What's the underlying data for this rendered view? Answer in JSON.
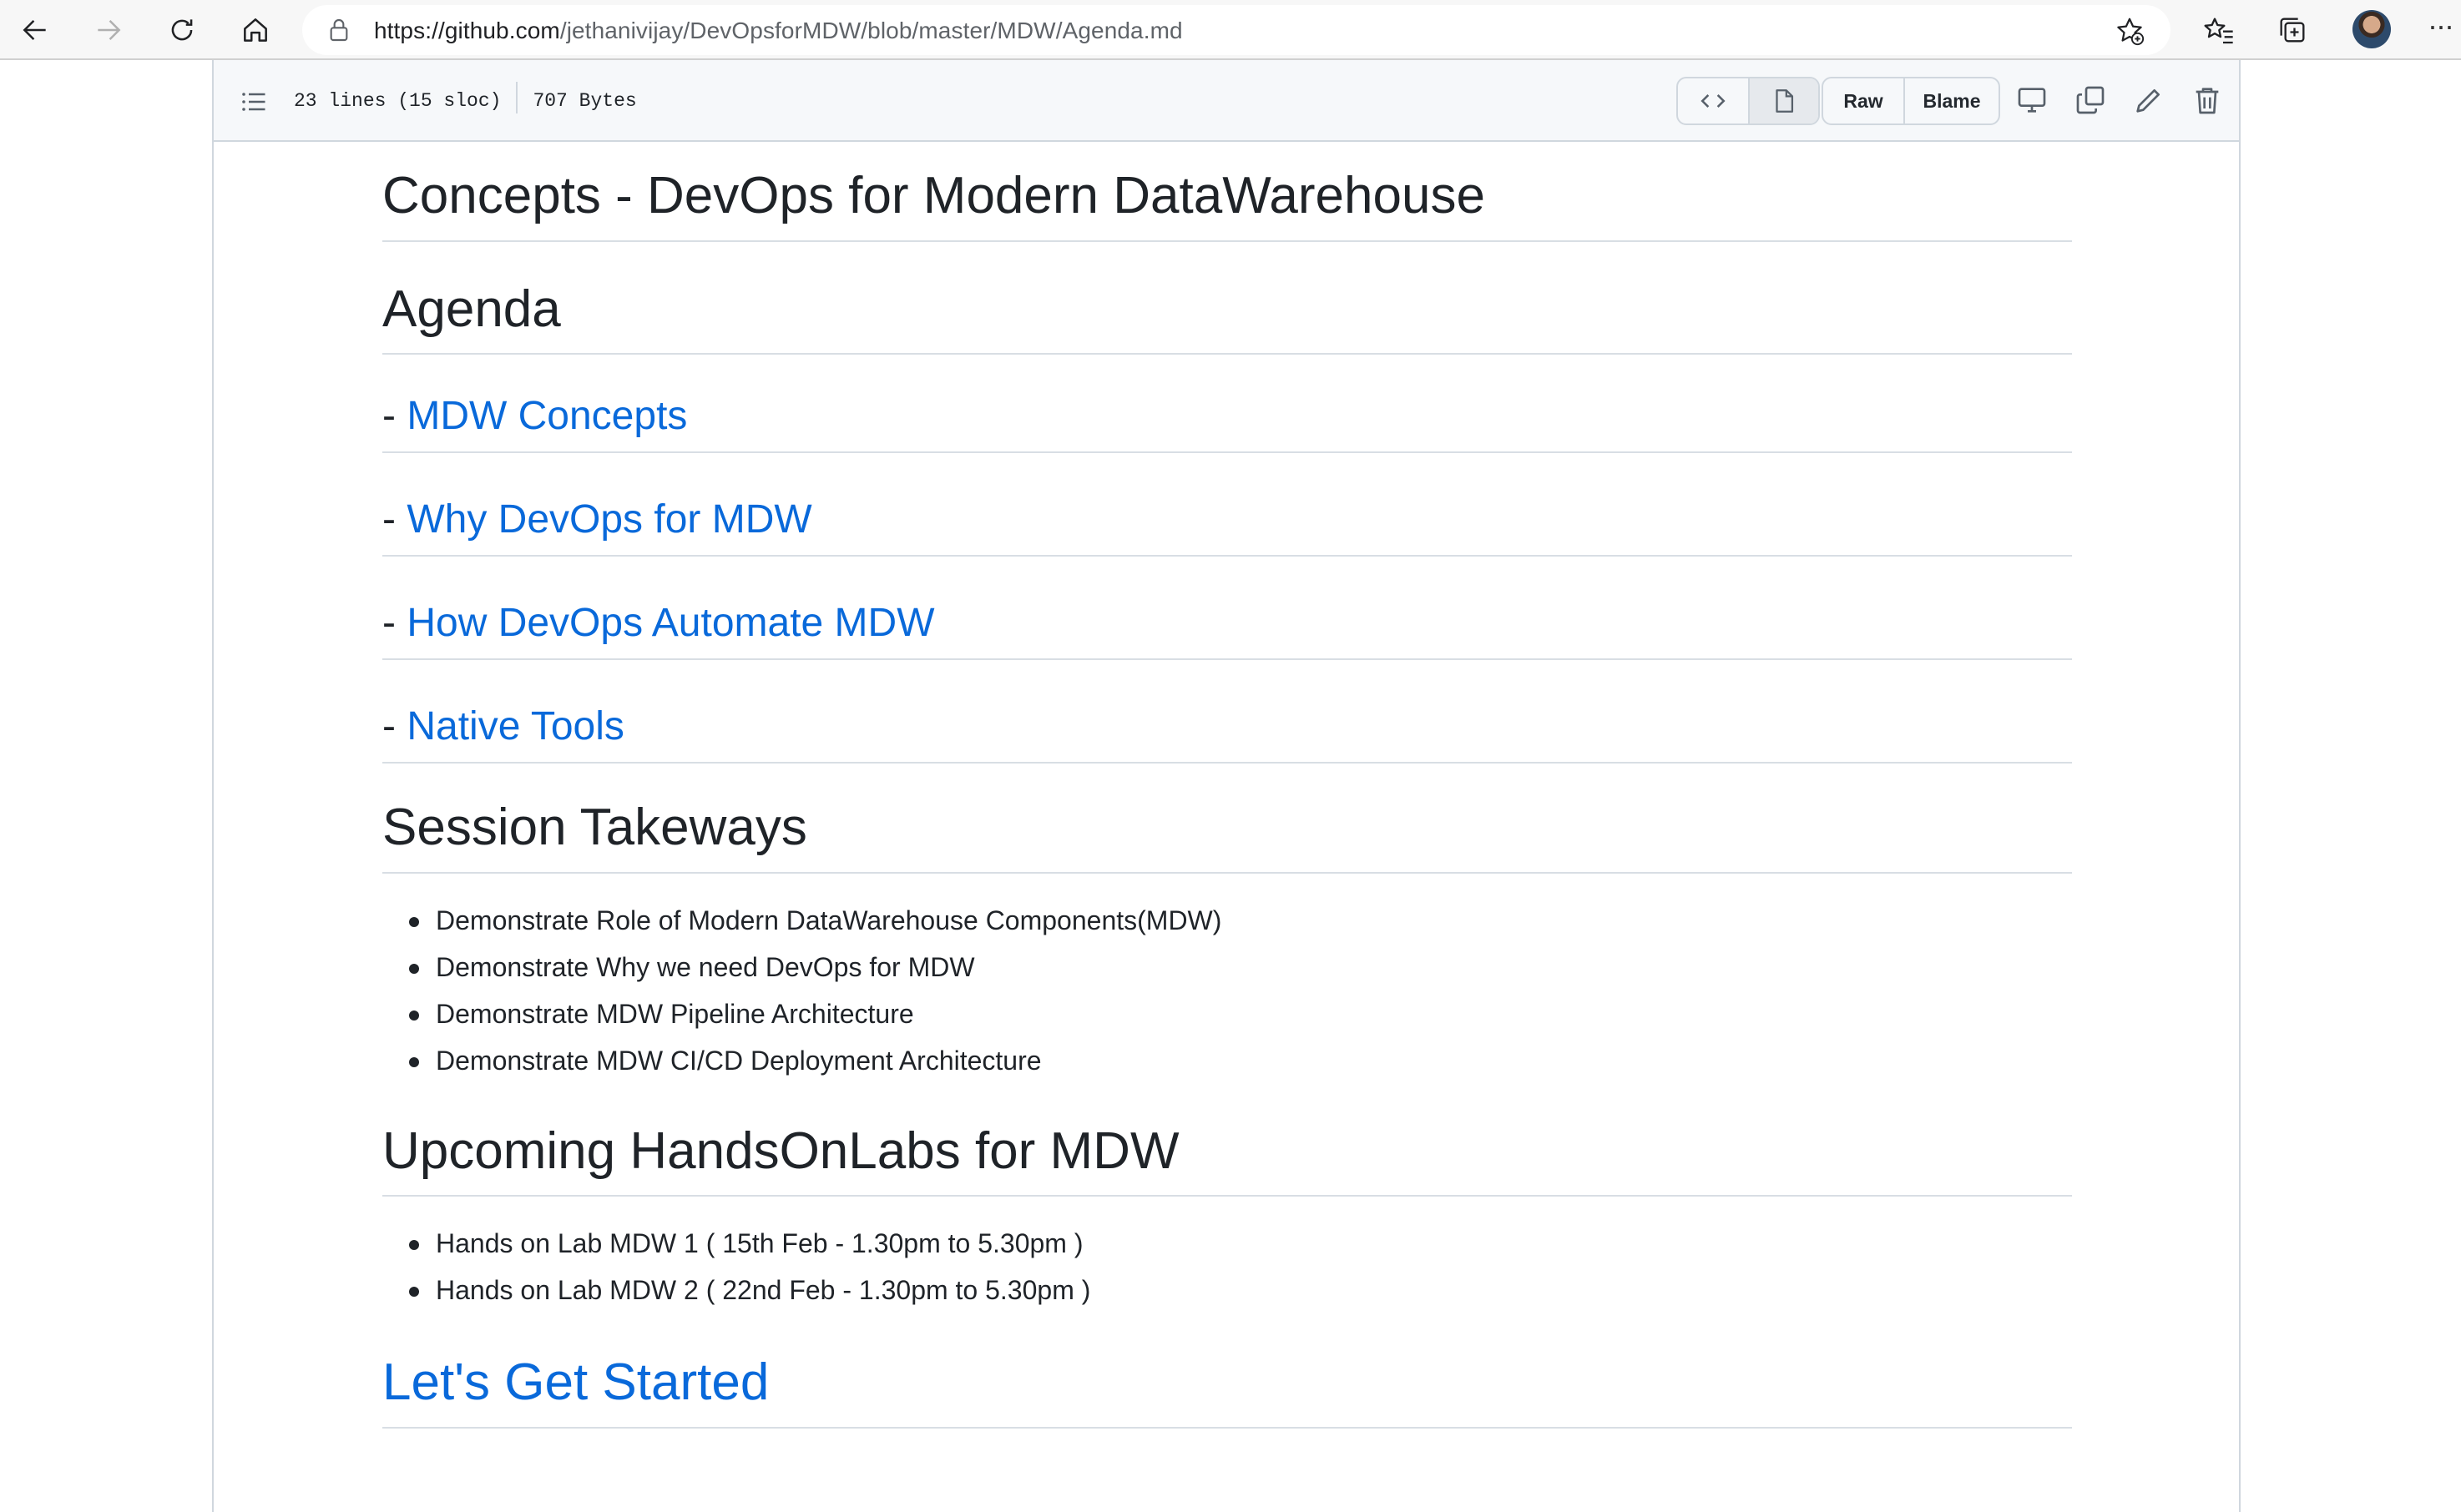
{
  "browser": {
    "url_host": "https://github.com",
    "url_path": "/jethanivijay/DevOpsforMDW/blob/master/MDW/Agenda.md",
    "more_label": "···"
  },
  "file": {
    "lines": "23 lines (15 sloc)",
    "size": "707 Bytes",
    "raw_label": "Raw",
    "blame_label": "Blame"
  },
  "content": {
    "title": "Concepts - DevOps for Modern DataWarehouse",
    "agenda_heading": "Agenda",
    "agenda_items": [
      {
        "prefix": "- ",
        "link": "MDW Concepts"
      },
      {
        "prefix": "- ",
        "link": "Why DevOps for MDW"
      },
      {
        "prefix": "- ",
        "link": "How DevOps Automate MDW"
      },
      {
        "prefix": "- ",
        "link": "Native Tools"
      }
    ],
    "takeaways_heading": "Session Takeways",
    "takeaways": [
      "Demonstrate Role of Modern DataWarehouse Components(MDW)",
      "Demonstrate Why we need DevOps for MDW",
      "Demonstrate MDW Pipeline Architecture",
      "Demonstrate MDW CI/CD Deployment Architecture"
    ],
    "labs_heading": "Upcoming HandsOnLabs for MDW",
    "labs": [
      "Hands on Lab MDW 1 ( 15th Feb - 1.30pm to 5.30pm )",
      "Hands on Lab MDW 2 ( 22nd Feb - 1.30pm to 5.30pm )"
    ],
    "get_started": "Let's Get Started"
  },
  "colors": {
    "link": "#0969da",
    "text": "#1f2328",
    "divider": "#d8dee4"
  }
}
